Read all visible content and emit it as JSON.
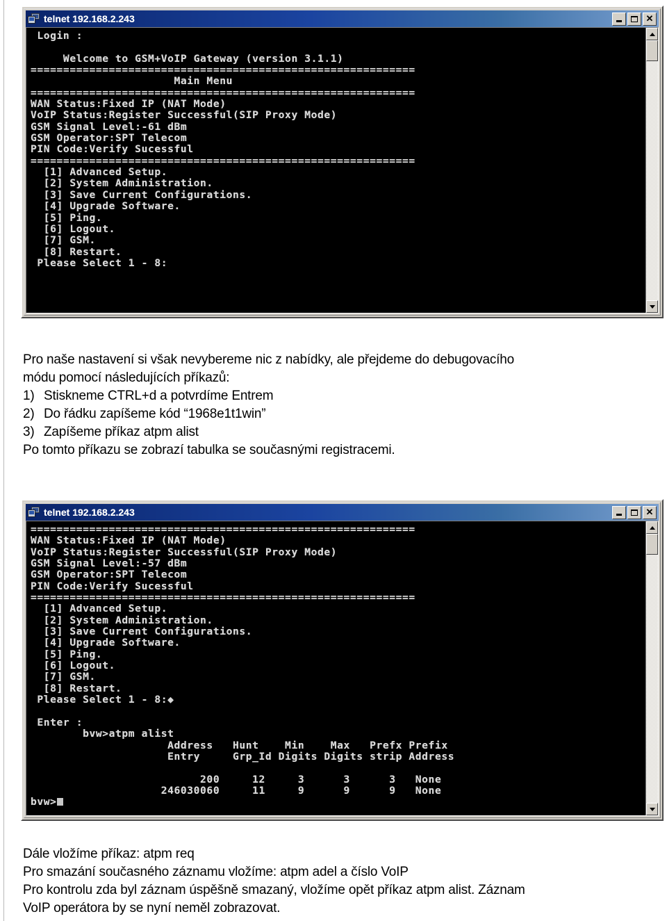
{
  "document": {
    "language": "cs"
  },
  "window1": {
    "title": "telnet 192.168.2.243",
    "icon": "computer-icon",
    "buttons": {
      "minimize": "minimize",
      "maximize": "maximize",
      "close": "close"
    },
    "terminal_lines": [
      " Login :",
      "",
      "     Welcome to GSM+VoIP Gateway (version 3.1.1)",
      "===========================================================",
      "                      Main Menu",
      "===========================================================",
      "WAN Status:Fixed IP (NAT Mode)",
      "VoIP Status:Register Successful(SIP Proxy Mode)",
      "GSM Signal Level:-61 dBm",
      "GSM Operator:SPT Telecom",
      "PIN Code:Verify Sucessful",
      "===========================================================",
      "  [1] Advanced Setup.",
      "  [2] System Administration.",
      "  [3] Save Current Configurations.",
      "  [4] Upgrade Software.",
      "  [5] Ping.",
      "  [6] Logout.",
      "  [7] GSM.",
      "  [8] Restart.",
      " Please Select 1 - 8:"
    ]
  },
  "prose1": {
    "line1": "Pro naše nastavení si však nevybereme nic z nabídky, ale přejdeme do debugovacího",
    "line2": "módu pomocí následujících příkazů:",
    "steps": [
      {
        "num": "1)",
        "text": "Stiskneme CTRL+d a potvrdíme Entrem"
      },
      {
        "num": "2)",
        "text": "Do řádku zapíšeme kód “1968e1t1win”"
      },
      {
        "num": "3)",
        "text": "Zapíšeme příkaz  atpm alist"
      }
    ],
    "line3": "Po tomto příkazu se zobrazí tabulka se současnými registracemi."
  },
  "window2": {
    "title": "telnet 192.168.2.243",
    "icon": "computer-icon",
    "buttons": {
      "minimize": "minimize",
      "maximize": "maximize",
      "close": "close"
    },
    "terminal_lines": [
      "===========================================================",
      "WAN Status:Fixed IP (NAT Mode)",
      "VoIP Status:Register Successful(SIP Proxy Mode)",
      "GSM Signal Level:-57 dBm",
      "GSM Operator:SPT Telecom",
      "PIN Code:Verify Sucessful",
      "===========================================================",
      "  [1] Advanced Setup.",
      "  [2] System Administration.",
      "  [3] Save Current Configurations.",
      "  [4] Upgrade Software.",
      "  [5] Ping.",
      "  [6] Logout.",
      "  [7] GSM.",
      "  [8] Restart.",
      " Please Select 1 - 8:◆",
      "",
      " Enter :",
      "        bvw>atpm alist",
      "                     Address   Hunt    Min    Max   Prefx Prefix",
      "                     Entry     Grp_Id Digits Digits strip Address",
      "",
      "                          200     12     3      3      3   None",
      "                    246030060     11     9      9      9   None"
    ],
    "prompt": "bvw>",
    "atpm_table": {
      "headers_row1": [
        "Address",
        "Hunt",
        "Min",
        "Max",
        "Prefx",
        "Prefix"
      ],
      "headers_row2": [
        "Entry",
        "Grp_Id",
        "Digits",
        "Digits",
        "strip",
        "Address"
      ],
      "rows": [
        {
          "address_entry": "200",
          "hunt_grp_id": "12",
          "min_digits": "3",
          "max_digits": "3",
          "prefx_strip": "3",
          "prefix_address": "None"
        },
        {
          "address_entry": "246030060",
          "hunt_grp_id": "11",
          "min_digits": "9",
          "max_digits": "9",
          "prefx_strip": "9",
          "prefix_address": "None"
        }
      ]
    }
  },
  "prose2": {
    "line1": "Dále vložíme příkaz: atpm req",
    "line2": "Pro smazání současného záznamu vložíme: atpm adel a číslo VoIP",
    "line3": "Pro kontrolu zda byl záznam úspěšně smazaný, vložíme opět příkaz atpm alist. Záznam",
    "line4": "VoIP operátora by se nyní neměl zobrazovat."
  },
  "colors": {
    "titlebar_start": "#0a246a",
    "titlebar_end": "#7aa0d0",
    "window_face": "#d4d0c8",
    "terminal_bg": "#000000",
    "terminal_fg": "#d8d8d8",
    "page_bg": "#ffffff"
  }
}
